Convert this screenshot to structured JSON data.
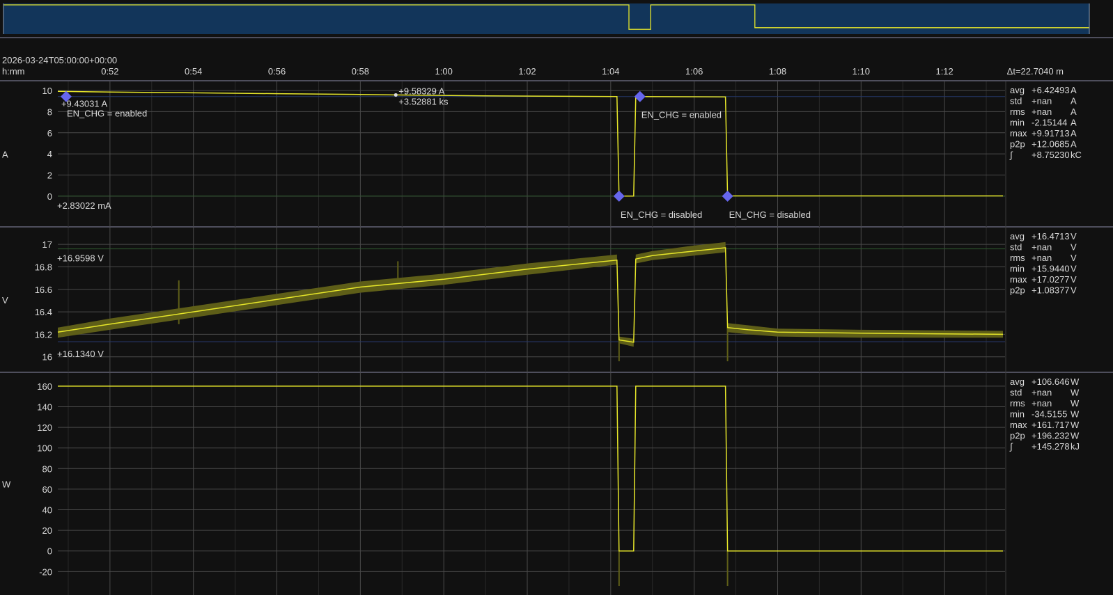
{
  "colors": {
    "background": "#111111",
    "overview_fill": "#12355a",
    "trace": "#e6e62a",
    "trace_band": "#5e5e18",
    "separator": "#8a8aa8",
    "grid_major": "#4a4a4a",
    "grid_minor": "#2a2a2a",
    "marker": "#6666ee",
    "min_line": "#26386a",
    "max_line": "#2e5a2e"
  },
  "header": {
    "start_time": "2026-03-24T05:00:00+00:00",
    "unit_label": "h:mm",
    "delta": "Δt=22.7040 m"
  },
  "chart_data": {
    "type": "line",
    "x_ticks": [
      "0:52",
      "0:54",
      "0:56",
      "0:58",
      "1:00",
      "1:02",
      "1:04",
      "1:06",
      "1:08",
      "1:10",
      "1:12"
    ],
    "x_range_min": [
      50.75,
      73.45
    ],
    "overview": {
      "x_range_min": [
        0,
        100
      ],
      "highlight": "full",
      "series": [
        [
          0,
          1
        ],
        [
          57.6,
          1
        ],
        [
          57.6,
          0.12
        ],
        [
          59.6,
          0.12
        ],
        [
          59.6,
          1
        ],
        [
          69.2,
          1
        ],
        [
          69.2,
          0.18
        ],
        [
          100,
          0.18
        ]
      ]
    },
    "plots": [
      {
        "unit": "A",
        "ylim": [
          -1,
          10.4
        ],
        "yticks": [
          "10",
          "8",
          "6",
          "4",
          "2",
          "0"
        ],
        "ytick_values": [
          10,
          8,
          6,
          4,
          2,
          0
        ],
        "series": [
          [
            50.75,
            9.92
          ],
          [
            52,
            9.85
          ],
          [
            54,
            9.78
          ],
          [
            56,
            9.7
          ],
          [
            58,
            9.63
          ],
          [
            59.5,
            9.55
          ],
          [
            61,
            9.5
          ],
          [
            63,
            9.45
          ],
          [
            64.15,
            9.43
          ],
          [
            64.2,
            0.0
          ],
          [
            64.55,
            0.0
          ],
          [
            64.6,
            9.43
          ],
          [
            66.75,
            9.4
          ],
          [
            66.8,
            0.02
          ],
          [
            73.4,
            0.02
          ]
        ],
        "band": [],
        "min_line": 9.43031,
        "max_line": 0.00283,
        "annotations": [
          {
            "x": 50.95,
            "y": 9.43,
            "label": "+9.43031 A",
            "label2": "EN_CHG = enabled"
          },
          {
            "x": 64.2,
            "y": 0.0,
            "label": "EN_CHG = disabled"
          },
          {
            "x": 64.7,
            "y": 9.43,
            "label": "EN_CHG = enabled"
          },
          {
            "x": 66.8,
            "y": 0.0,
            "label": "EN_CHG = disabled"
          }
        ],
        "cursor": {
          "x": 58.85,
          "y": 9.58,
          "label": "+9.58329 A",
          "label2": "+3.52881 ks"
        },
        "value_labels": {
          "top": "+9.43031 A",
          "bottom": "+2.83022 mA"
        },
        "stats": [
          {
            "name": "avg",
            "value": "+6.42493",
            "unit": "A"
          },
          {
            "name": "std",
            "value": "+nan",
            "unit": "A"
          },
          {
            "name": "rms",
            "value": "+nan",
            "unit": "A"
          },
          {
            "name": "min",
            "value": "-2.15144",
            "unit": "A"
          },
          {
            "name": "max",
            "value": "+9.91713",
            "unit": "A"
          },
          {
            "name": "p2p",
            "value": "+12.0685",
            "unit": "A"
          },
          {
            "name": "∫",
            "value": "+8.75230",
            "unit": "kC"
          }
        ]
      },
      {
        "unit": "V",
        "ylim": [
          15.93,
          17.1
        ],
        "yticks": [
          "17",
          "16.8",
          "16.6",
          "16.4",
          "16.2",
          "16"
        ],
        "ytick_values": [
          17,
          16.8,
          16.6,
          16.4,
          16.2,
          16
        ],
        "series": [
          [
            50.75,
            16.22
          ],
          [
            52,
            16.29
          ],
          [
            54,
            16.4
          ],
          [
            56,
            16.51
          ],
          [
            58,
            16.62
          ],
          [
            60,
            16.69
          ],
          [
            62,
            16.78
          ],
          [
            64.15,
            16.86
          ],
          [
            64.2,
            16.15
          ],
          [
            64.55,
            16.13
          ],
          [
            64.6,
            16.87
          ],
          [
            65,
            16.9
          ],
          [
            66,
            16.94
          ],
          [
            66.75,
            16.97
          ],
          [
            66.8,
            16.26
          ],
          [
            67.3,
            16.24
          ],
          [
            68,
            16.22
          ],
          [
            70,
            16.21
          ],
          [
            73.4,
            16.2
          ]
        ],
        "band": [
          [
            50.75,
            16.17,
            16.26
          ],
          [
            52,
            16.24,
            16.34
          ],
          [
            54,
            16.35,
            16.45
          ],
          [
            56,
            16.46,
            16.56
          ],
          [
            58,
            16.57,
            16.67
          ],
          [
            60,
            16.64,
            16.74
          ],
          [
            62,
            16.73,
            16.83
          ],
          [
            64.15,
            16.82,
            16.91
          ],
          [
            64.2,
            16.12,
            16.18
          ],
          [
            64.55,
            16.09,
            16.16
          ],
          [
            64.6,
            16.83,
            16.91
          ],
          [
            65,
            16.86,
            16.94
          ],
          [
            66,
            16.9,
            16.99
          ],
          [
            66.75,
            16.93,
            17.02
          ],
          [
            66.8,
            16.22,
            16.3
          ],
          [
            67.3,
            16.2,
            16.28
          ],
          [
            68,
            16.18,
            16.25
          ],
          [
            70,
            16.17,
            16.24
          ],
          [
            73.4,
            16.17,
            16.23
          ]
        ],
        "spikes": [
          [
            53.65,
            16.68
          ],
          [
            58.9,
            16.85
          ],
          [
            64.2,
            15.96
          ],
          [
            66.8,
            15.96
          ]
        ],
        "min_line": 16.134,
        "max_line": 16.9598,
        "value_labels": {
          "top": "+16.9598 V",
          "bottom": "+16.1340 V"
        },
        "stats": [
          {
            "name": "avg",
            "value": "+16.4713",
            "unit": "V"
          },
          {
            "name": "std",
            "value": "+nan",
            "unit": "V"
          },
          {
            "name": "rms",
            "value": "+nan",
            "unit": "V"
          },
          {
            "name": "min",
            "value": "+15.9440",
            "unit": "V"
          },
          {
            "name": "max",
            "value": "+17.0277",
            "unit": "V"
          },
          {
            "name": "p2p",
            "value": "+1.08377",
            "unit": "V"
          }
        ]
      },
      {
        "unit": "W",
        "ylim": [
          -36,
          166
        ],
        "yticks": [
          "160",
          "140",
          "120",
          "100",
          "80",
          "60",
          "40",
          "20",
          "0",
          "-20"
        ],
        "ytick_values": [
          160,
          140,
          120,
          100,
          80,
          60,
          40,
          20,
          0,
          -20
        ],
        "series": [
          [
            50.75,
            160
          ],
          [
            64.15,
            160
          ],
          [
            64.2,
            0
          ],
          [
            64.55,
            0
          ],
          [
            64.6,
            160
          ],
          [
            66.75,
            160
          ],
          [
            66.8,
            0
          ],
          [
            73.4,
            0
          ]
        ],
        "band": [],
        "spikes": [
          [
            64.2,
            -34
          ],
          [
            66.8,
            -34
          ]
        ],
        "stats": [
          {
            "name": "avg",
            "value": "+106.646",
            "unit": "W"
          },
          {
            "name": "std",
            "value": "+nan",
            "unit": "W"
          },
          {
            "name": "rms",
            "value": "+nan",
            "unit": "W"
          },
          {
            "name": "min",
            "value": "-34.5155",
            "unit": "W"
          },
          {
            "name": "max",
            "value": "+161.717",
            "unit": "W"
          },
          {
            "name": "p2p",
            "value": "+196.232",
            "unit": "W"
          },
          {
            "name": "∫",
            "value": "+145.278",
            "unit": "kJ"
          }
        ]
      }
    ]
  }
}
